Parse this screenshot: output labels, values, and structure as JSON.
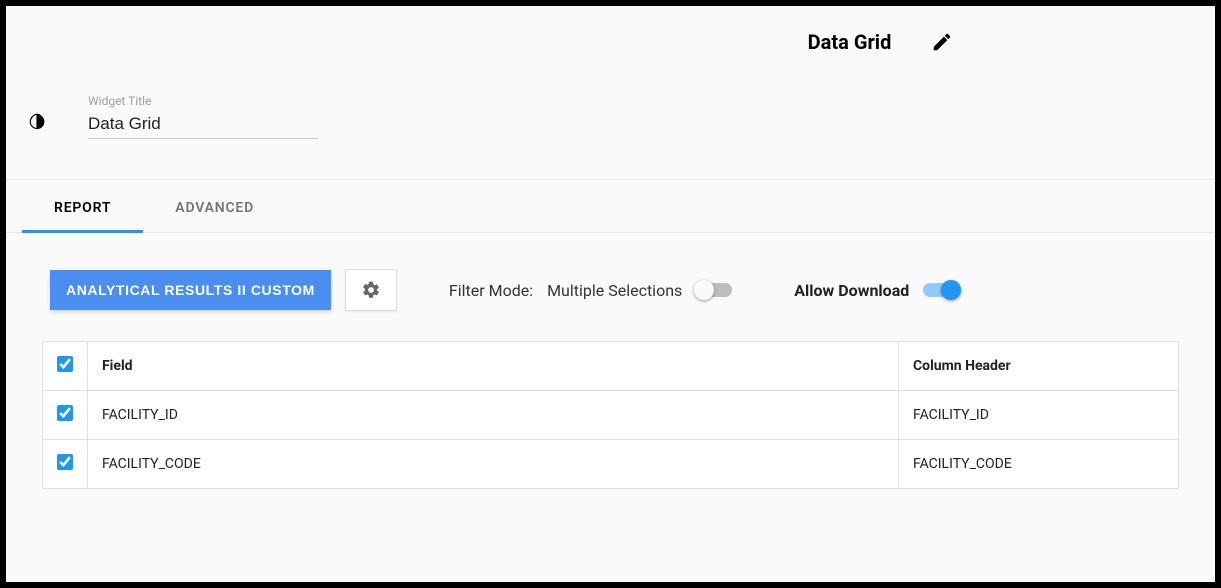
{
  "header": {
    "title": "Data Grid"
  },
  "widget": {
    "label": "Widget Title",
    "value": "Data Grid"
  },
  "tabs": {
    "report": "REPORT",
    "advanced": "ADVANCED"
  },
  "toolbar": {
    "primary_button": "ANALYTICAL RESULTS II CUSTOM",
    "filter_label": "Filter Mode:",
    "filter_value": "Multiple Selections",
    "allow_download": "Allow Download"
  },
  "table": {
    "headers": {
      "field": "Field",
      "column_header": "Column Header"
    },
    "rows": [
      {
        "field": "FACILITY_ID",
        "column_header": "FACILITY_ID"
      },
      {
        "field": "FACILITY_CODE",
        "column_header": "FACILITY_CODE"
      }
    ]
  }
}
